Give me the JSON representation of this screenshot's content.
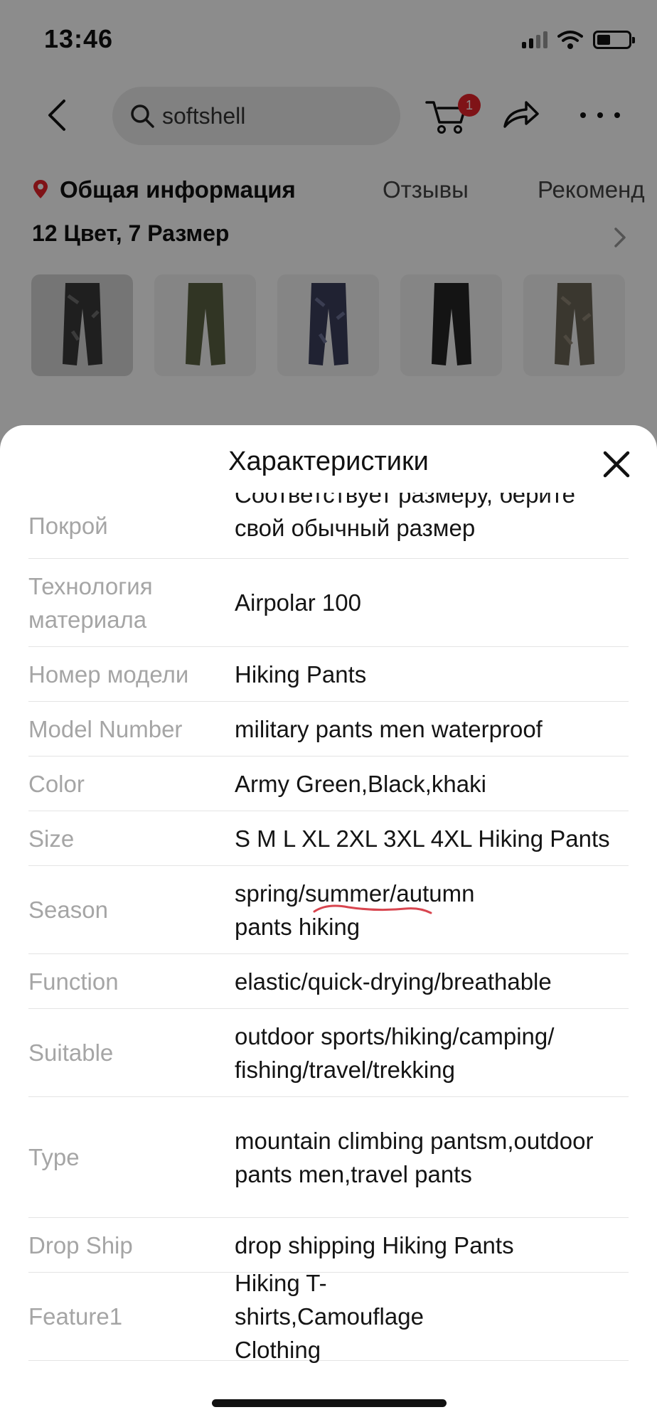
{
  "status_bar": {
    "time": "13:46"
  },
  "header": {
    "search_value": "softshell",
    "cart_badge": "1"
  },
  "tabs": {
    "info": "Общая информация",
    "reviews": "Отзывы",
    "recommendations": "Рекоменд"
  },
  "variants_summary": "12 Цвет, 7 Размер",
  "sheet": {
    "title": "Характеристики",
    "rows": [
      {
        "key": "Покрой",
        "value": "Соответствует размеру, берите свой обычный размер"
      },
      {
        "key": "Технология материала",
        "value": "Airpolar 100"
      },
      {
        "key": "Номер модели",
        "value": "Hiking Pants"
      },
      {
        "key": "Model Number",
        "value": "military pants men waterproof"
      },
      {
        "key": "Color",
        "value": "Army Green,Black,khaki"
      },
      {
        "key": "Size",
        "value": "S M L XL 2XL 3XL 4XL Hiking Pants"
      },
      {
        "key": "Season",
        "value": "spring/summer/autumn pants hiking"
      },
      {
        "key": "Function",
        "value": "elastic/quick-drying/breathable"
      },
      {
        "key": "Suitable",
        "value": "outdoor sports/hiking/camping/ fishing/travel/trekking"
      },
      {
        "key": "Type",
        "value": "mountain climbing pantsm,outdoor pants men,travel pants"
      },
      {
        "key": "Drop Ship",
        "value": "drop shipping Hiking Pants"
      },
      {
        "key": "Feature1",
        "value": "Hiking T-shirts,Camouflage Clothing"
      }
    ]
  },
  "colors": {
    "accent": "#e8232b",
    "underline_mark": "#d8454f"
  }
}
